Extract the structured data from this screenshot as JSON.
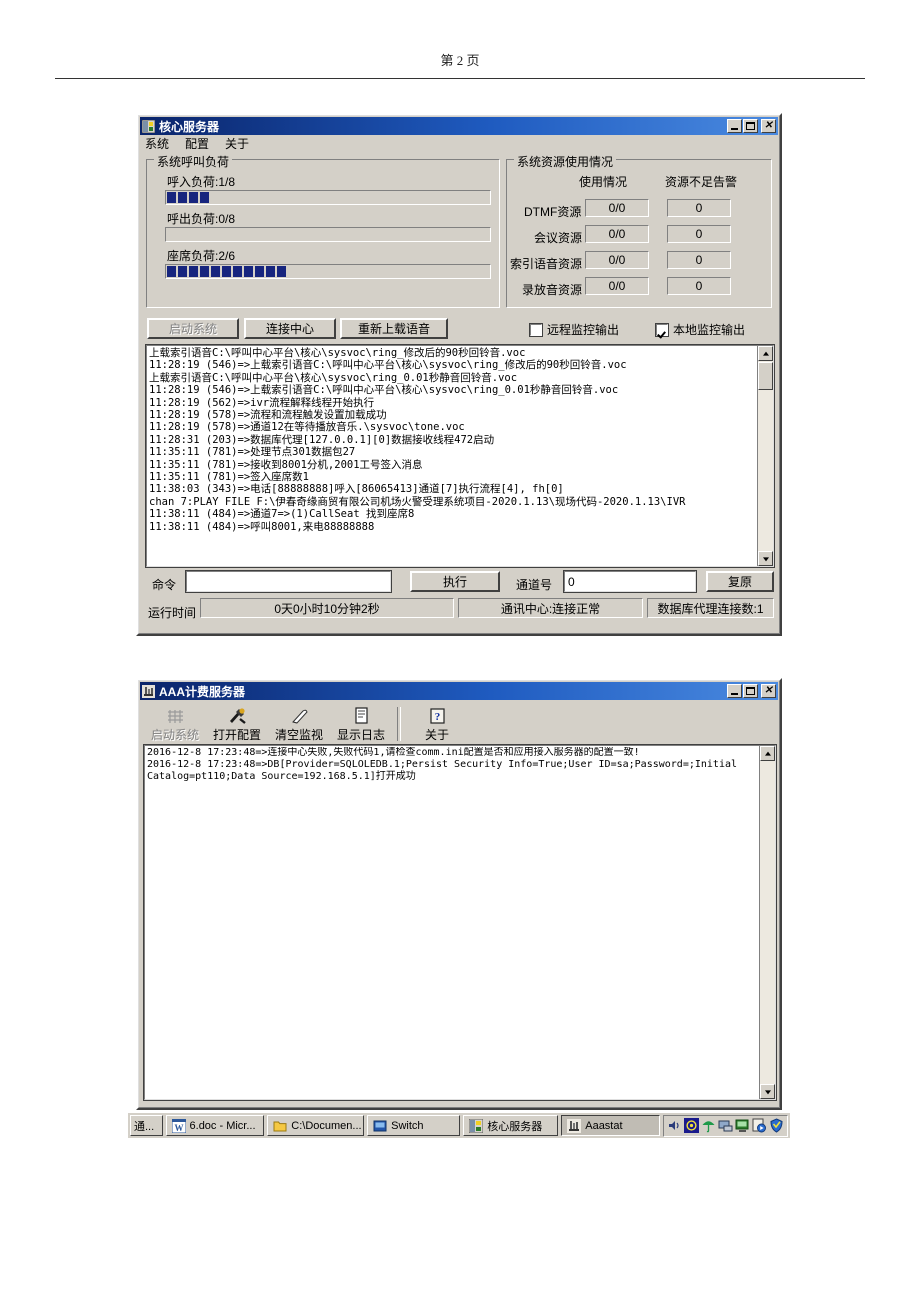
{
  "page": {
    "header": "第 2 页"
  },
  "core_window": {
    "title": "核心服务器",
    "icon": "app-icon",
    "window_buttons": {
      "minimize": "_",
      "maximize": "□",
      "close": "✕"
    },
    "menu": [
      "系统",
      "配置",
      "关于"
    ],
    "call_load_group": {
      "title": "系统呼叫负荷",
      "bars": [
        {
          "label": "呼入负荷:1/8",
          "filled_blocks": 4
        },
        {
          "label": "呼出负荷:0/8",
          "filled_blocks": 0
        },
        {
          "label": "座席负荷:2/6",
          "filled_blocks": 11
        }
      ]
    },
    "resource_group": {
      "title": "系统资源使用情况",
      "columns": [
        "使用情况",
        "资源不足告警"
      ],
      "rows": [
        {
          "name": "DTMF资源",
          "usage": "0/0",
          "alarm": "0"
        },
        {
          "name": "会议资源",
          "usage": "0/0",
          "alarm": "0"
        },
        {
          "name": "索引语音资源",
          "usage": "0/0",
          "alarm": "0"
        },
        {
          "name": "录放音资源",
          "usage": "0/0",
          "alarm": "0"
        }
      ]
    },
    "buttons": {
      "start_system": "启动系统",
      "connect_center": "连接中心",
      "reload_voice": "重新上载语音"
    },
    "checkboxes": {
      "remote_monitor": {
        "label": "远程监控输出",
        "checked": false
      },
      "local_monitor": {
        "label": "本地监控输出",
        "checked": true
      }
    },
    "log": "上载索引语音C:\\呼叫中心平台\\核心\\sysvoc\\ring_修改后的90秒回铃音.voc\n11:28:19 (546)=>上载索引语音C:\\呼叫中心平台\\核心\\sysvoc\\ring_修改后的90秒回铃音.voc\n上载索引语音C:\\呼叫中心平台\\核心\\sysvoc\\ring_0.01秒静音回铃音.voc\n11:28:19 (546)=>上载索引语音C:\\呼叫中心平台\\核心\\sysvoc\\ring_0.01秒静音回铃音.voc\n11:28:19 (562)=>ivr流程解释线程开始执行\n11:28:19 (578)=>流程和流程触发设置加载成功\n11:28:19 (578)=>通道12在等待播放音乐.\\sysvoc\\tone.voc\n11:28:31 (203)=>数据库代理[127.0.0.1][0]数据接收线程472启动\n11:35:11 (781)=>处理节点301数据包27\n11:35:11 (781)=>接收到8001分机,2001工号签入消息\n11:35:11 (781)=>签入座席数1\n11:38:03 (343)=>电话[88888888]呼入[86065413]通道[7]执行流程[4], fh[0]\nchan 7:PLAY FILE F:\\伊春奇缘商贸有限公司机场火警受理系统项目-2020.1.13\\现场代码-2020.1.13\\IVR\n11:38:11 (484)=>通道7=>(1)CallSeat 找到座席8\n11:38:11 (484)=>呼叫8001,来电88888888\n",
    "command_row": {
      "command_label": "命令",
      "command_value": "",
      "execute_button": "执行",
      "channel_label": "通道号",
      "channel_value": "0",
      "restore_button": "复原"
    },
    "status_bar": {
      "runtime_label": "运行时间",
      "runtime_value": "0天0小时10分钟2秒",
      "comm_center": "通讯中心:连接正常",
      "db_agent": "数据库代理连接数:1"
    }
  },
  "aaa_window": {
    "title": "AAA计费服务器",
    "icon": "app-icon",
    "window_buttons": {
      "minimize": "_",
      "maximize": "□",
      "close": "✕"
    },
    "toolbar": [
      {
        "label": "启动系统",
        "icon": "grid-icon",
        "disabled": true
      },
      {
        "label": "打开配置",
        "icon": "tools-icon",
        "disabled": false
      },
      {
        "label": "清空监视",
        "icon": "eraser-icon",
        "disabled": false
      },
      {
        "label": "显示日志",
        "icon": "document-icon",
        "disabled": false
      },
      {
        "label": "关于",
        "icon": "help-icon",
        "disabled": false
      }
    ],
    "log": "2016-12-8 17:23:48=>连接中心失败,失败代码1,请检查comm.ini配置是否和应用接入服务器的配置一致!\n2016-12-8 17:23:48=>DB[Provider=SQLOLEDB.1;Persist Security Info=True;User ID=sa;Password=;Initial\nCatalog=pt110;Data Source=192.168.5.1]打开成功\n"
  },
  "taskbar": {
    "items": [
      {
        "label": "通...",
        "icon": "generic-icon",
        "active": false
      },
      {
        "label": "6.doc - Micr...",
        "icon": "word-icon",
        "active": false
      },
      {
        "label": "C:\\Documen...",
        "icon": "folder-icon",
        "active": false
      },
      {
        "label": "Switch",
        "icon": "switch-icon",
        "active": false
      },
      {
        "label": "核心服务器",
        "icon": "core-server-icon",
        "active": false
      },
      {
        "label": "Aaastat",
        "icon": "aaastat-icon",
        "active": true
      }
    ],
    "tray_icons": [
      "volume-icon",
      "network-icon",
      "umbrella-icon",
      "monitor-icon",
      "display-icon",
      "media-icon",
      "shield-icon"
    ]
  },
  "colors": {
    "desktop": "#d4d0c8",
    "titlebar_active": "#0a246a",
    "progress_chunk": "#17257e",
    "text": "#000000"
  }
}
